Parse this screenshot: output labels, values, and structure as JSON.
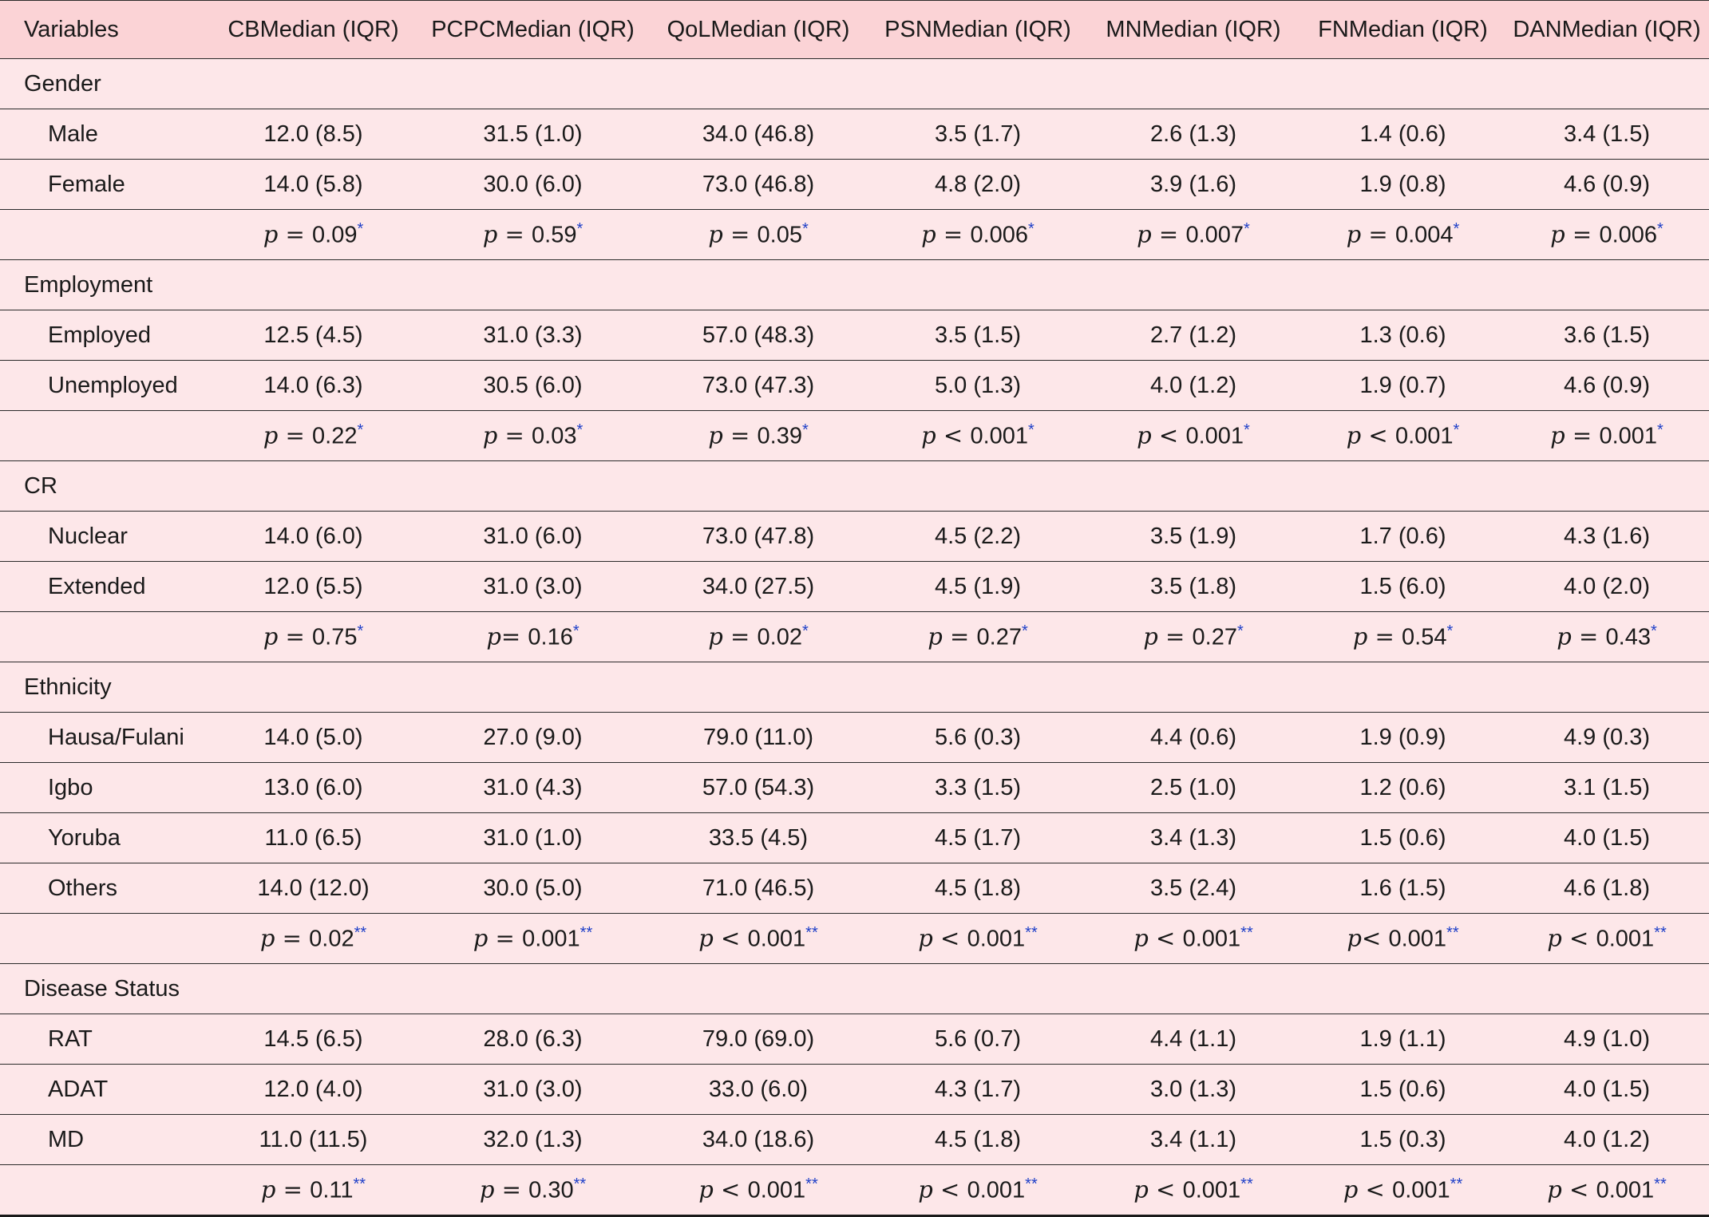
{
  "headers": [
    "Variables",
    "CBMedian (IQR)",
    "PCPCMedian (IQR)",
    "QoLMedian (IQR)",
    "PSNMedian (IQR)",
    "MNMedian (IQR)",
    "FNMedian (IQR)",
    "DANMedian (IQR)"
  ],
  "groups": [
    {
      "title": "Gender",
      "rows": [
        {
          "label": "Male",
          "values": [
            "12.0 (8.5)",
            "31.5 (1.0)",
            "34.0 (46.8)",
            "3.5 (1.7)",
            "2.6 (1.3)",
            "1.4 (0.6)",
            "3.4 (1.5)"
          ]
        },
        {
          "label": "Female",
          "values": [
            "14.0 (5.8)",
            "30.0 (6.0)",
            "73.0 (46.8)",
            "4.8 (2.0)",
            "3.9 (1.6)",
            "1.9 (0.8)",
            "4.6 (0.9)"
          ]
        }
      ],
      "p": [
        {
          "p": "p",
          "op": " = ",
          "v": "0.09",
          "star": "*"
        },
        {
          "p": "p",
          "op": " = ",
          "v": "0.59",
          "star": "*"
        },
        {
          "p": "p",
          "op": " = ",
          "v": "0.05",
          "star": "*"
        },
        {
          "p": "p",
          "op": " = ",
          "v": "0.006",
          "star": "*"
        },
        {
          "p": "p",
          "op": " = ",
          "v": "0.007",
          "star": "*"
        },
        {
          "p": "p",
          "op": " = ",
          "v": "0.004",
          "star": "*"
        },
        {
          "p": "p",
          "op": " = ",
          "v": "0.006",
          "star": "*"
        }
      ]
    },
    {
      "title": "Employment",
      "rows": [
        {
          "label": "Employed",
          "values": [
            "12.5 (4.5)",
            "31.0 (3.3)",
            "57.0 (48.3)",
            "3.5 (1.5)",
            "2.7 (1.2)",
            "1.3 (0.6)",
            "3.6 (1.5)"
          ]
        },
        {
          "label": "Unemployed",
          "values": [
            "14.0 (6.3)",
            "30.5 (6.0)",
            "73.0 (47.3)",
            "5.0 (1.3)",
            "4.0 (1.2)",
            "1.9 (0.7)",
            "4.6 (0.9)"
          ]
        }
      ],
      "p": [
        {
          "p": "p",
          "op": " = ",
          "v": "0.22",
          "star": "*"
        },
        {
          "p": "p",
          "op": " = ",
          "v": "0.03",
          "star": "*"
        },
        {
          "p": "p",
          "op": " = ",
          "v": "0.39",
          "star": "*"
        },
        {
          "p": "p",
          "op": " < ",
          "v": "0.001",
          "star": "*"
        },
        {
          "p": "p",
          "op": " < ",
          "v": "0.001",
          "star": "*"
        },
        {
          "p": "p",
          "op": " < ",
          "v": "0.001",
          "star": "*"
        },
        {
          "p": "p",
          "op": " = ",
          "v": "0.001",
          "star": "*"
        }
      ]
    },
    {
      "title": "CR",
      "rows": [
        {
          "label": "Nuclear",
          "values": [
            "14.0 (6.0)",
            "31.0 (6.0)",
            "73.0 (47.8)",
            "4.5 (2.2)",
            "3.5 (1.9)",
            "1.7 (0.6)",
            "4.3 (1.6)"
          ]
        },
        {
          "label": "Extended",
          "values": [
            "12.0 (5.5)",
            "31.0 (3.0)",
            "34.0 (27.5)",
            "4.5 (1.9)",
            "3.5 (1.8)",
            "1.5 (6.0)",
            "4.0 (2.0)"
          ]
        }
      ],
      "p": [
        {
          "p": "p",
          "op": " = ",
          "v": "0.75",
          "star": "*"
        },
        {
          "p": "p",
          "op": "= ",
          "v": "0.16",
          "star": "*"
        },
        {
          "p": "p",
          "op": " = ",
          "v": "0.02",
          "star": "*"
        },
        {
          "p": "p",
          "op": " = ",
          "v": "0.27",
          "star": "*"
        },
        {
          "p": "p",
          "op": " = ",
          "v": "0.27",
          "star": "*"
        },
        {
          "p": "p",
          "op": " = ",
          "v": "0.54",
          "star": "*"
        },
        {
          "p": "p",
          "op": " = ",
          "v": "0.43",
          "star": "*"
        }
      ]
    },
    {
      "title": "Ethnicity",
      "rows": [
        {
          "label": "Hausa/Fulani",
          "values": [
            "14.0 (5.0)",
            "27.0 (9.0)",
            "79.0 (11.0)",
            "5.6 (0.3)",
            "4.4 (0.6)",
            "1.9 (0.9)",
            "4.9 (0.3)"
          ]
        },
        {
          "label": "Igbo",
          "values": [
            "13.0 (6.0)",
            "31.0 (4.3)",
            "57.0 (54.3)",
            "3.3 (1.5)",
            "2.5 (1.0)",
            "1.2 (0.6)",
            "3.1 (1.5)"
          ]
        },
        {
          "label": "Yoruba",
          "values": [
            "11.0 (6.5)",
            "31.0 (1.0)",
            "33.5 (4.5)",
            "4.5 (1.7)",
            "3.4 (1.3)",
            "1.5 (0.6)",
            "4.0 (1.5)"
          ]
        },
        {
          "label": "Others",
          "values": [
            "14.0 (12.0)",
            "30.0 (5.0)",
            "71.0 (46.5)",
            "4.5 (1.8)",
            "3.5 (2.4)",
            "1.6 (1.5)",
            "4.6 (1.8)"
          ]
        }
      ],
      "p": [
        {
          "p": "p",
          "op": " = ",
          "v": "0.02",
          "star": "**"
        },
        {
          "p": "p",
          "op": " = ",
          "v": "0.001",
          "star": "**"
        },
        {
          "p": "p",
          "op": " < ",
          "v": "0.001",
          "star": "**"
        },
        {
          "p": "p",
          "op": " < ",
          "v": "0.001",
          "star": "**"
        },
        {
          "p": "p",
          "op": " < ",
          "v": "0.001",
          "star": "**"
        },
        {
          "p": "p",
          "op": "< ",
          "v": "0.001",
          "star": "**"
        },
        {
          "p": "p",
          "op": " < ",
          "v": "0.001",
          "star": "**"
        }
      ]
    },
    {
      "title": "Disease Status",
      "rows": [
        {
          "label": "RAT",
          "values": [
            "14.5 (6.5)",
            "28.0 (6.3)",
            "79.0 (69.0)",
            "5.6 (0.7)",
            "4.4 (1.1)",
            "1.9 (1.1)",
            "4.9 (1.0)"
          ]
        },
        {
          "label": "ADAT",
          "values": [
            "12.0 (4.0)",
            "31.0 (3.0)",
            "33.0 (6.0)",
            "4.3 (1.7)",
            "3.0 (1.3)",
            "1.5 (0.6)",
            "4.0 (1.5)"
          ]
        },
        {
          "label": "MD",
          "values": [
            "11.0 (11.5)",
            "32.0 (1.3)",
            "34.0 (18.6)",
            "4.5 (1.8)",
            "3.4 (1.1)",
            "1.5 (0.3)",
            "4.0 (1.2)"
          ]
        }
      ],
      "p": [
        {
          "p": "p",
          "op": " = ",
          "v": "0.11",
          "star": "**"
        },
        {
          "p": "p",
          "op": " = ",
          "v": "0.30",
          "star": "**"
        },
        {
          "p": "p",
          "op": " < ",
          "v": "0.001",
          "star": "**"
        },
        {
          "p": "p",
          "op": " < ",
          "v": "0.001",
          "star": "**"
        },
        {
          "p": "p",
          "op": " < ",
          "v": "0.001",
          "star": "**"
        },
        {
          "p": "p",
          "op": " < ",
          "v": "0.001",
          "star": "**"
        },
        {
          "p": "p",
          "op": " < ",
          "v": "0.001",
          "star": "**"
        }
      ]
    }
  ]
}
